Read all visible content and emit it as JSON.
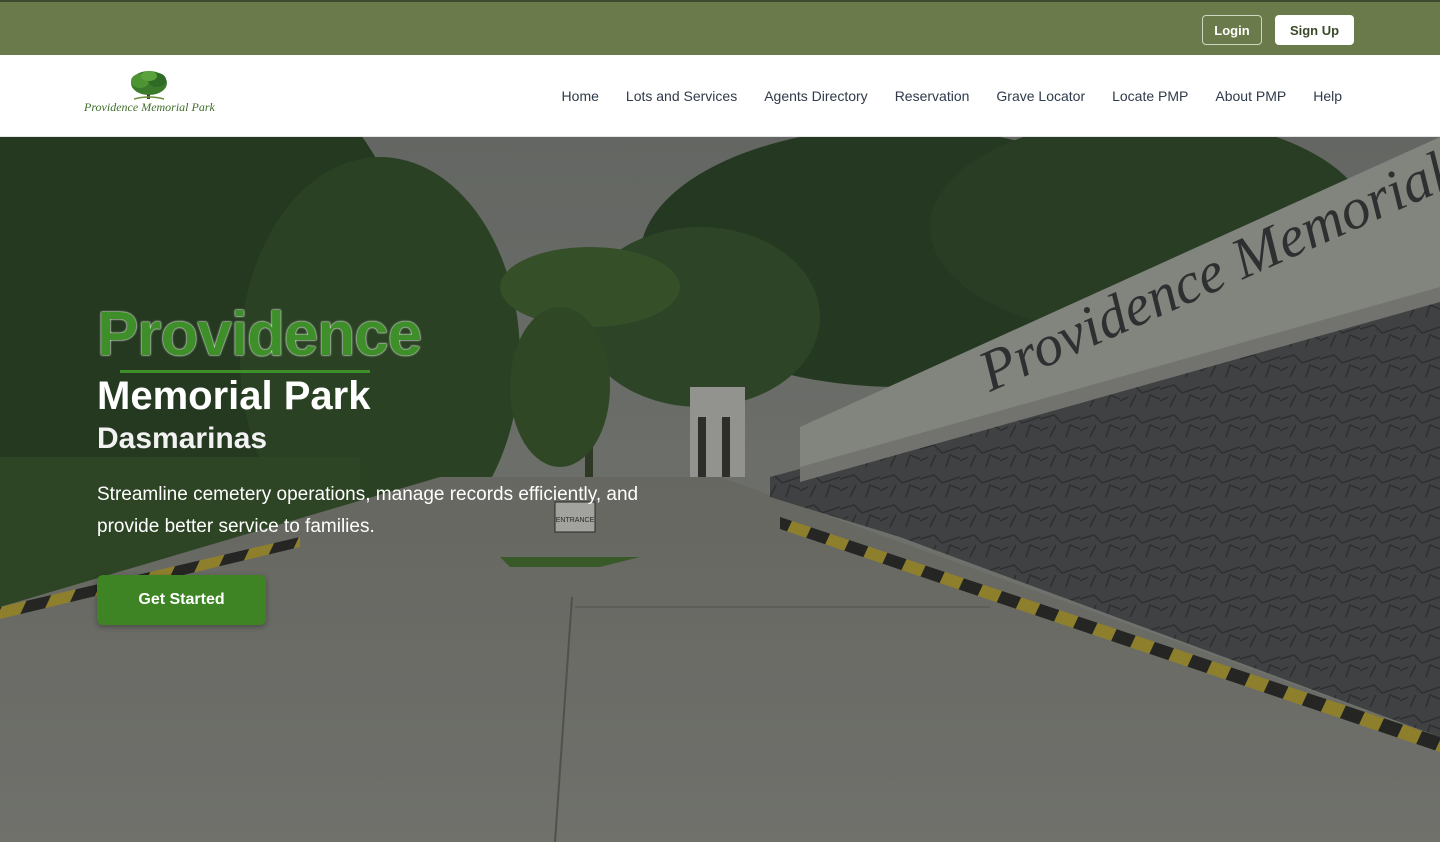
{
  "header": {
    "login_label": "Login",
    "signup_label": "Sign Up"
  },
  "brand": {
    "logo_text": "Providence Memorial Park"
  },
  "nav": {
    "items": [
      {
        "label": "Home"
      },
      {
        "label": "Lots and Services"
      },
      {
        "label": "Agents Directory"
      },
      {
        "label": "Reservation"
      },
      {
        "label": "Grave Locator"
      },
      {
        "label": "Locate PMP"
      },
      {
        "label": "About PMP"
      },
      {
        "label": "Help"
      }
    ]
  },
  "hero": {
    "title": "Providence",
    "subtitle": "Memorial Park",
    "location": "Dasmarinas",
    "description": "Streamline cemetery operations, manage records efficiently, and provide better service to families.",
    "cta_label": "Get Started",
    "wall_sign_text": "Providence Memorial Park",
    "entrance_sign_text": "ENTRANCE"
  },
  "colors": {
    "topbar": "#6a7a4a",
    "accent_green": "#3e8f2a",
    "cta_green": "#3e8424"
  }
}
